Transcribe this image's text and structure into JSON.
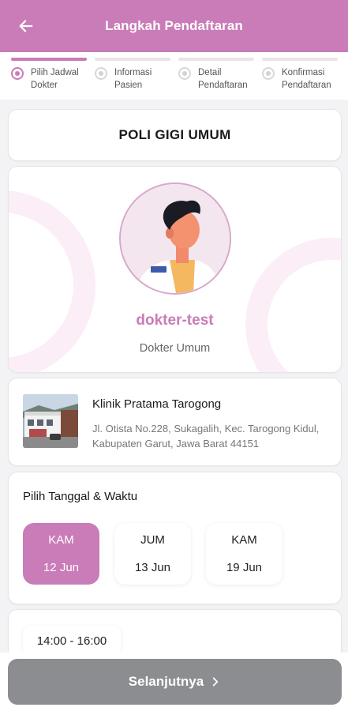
{
  "header": {
    "title": "Langkah Pendaftaran",
    "back_icon": "arrow-left-icon"
  },
  "stepper": {
    "accent": "#c97cb7",
    "steps": [
      {
        "label": "Pilih Jadwal Dokter",
        "active": true
      },
      {
        "label": "Informasi Pasien",
        "active": false
      },
      {
        "label": "Detail Pendaftaran",
        "active": false
      },
      {
        "label": "Konfirmasi Pendaftaran",
        "active": false
      }
    ]
  },
  "poli": {
    "title": "POLI GIGI UMUM"
  },
  "doctor": {
    "name": "dokter-test",
    "specialty": "Dokter Umum",
    "avatar_icon": "doctor-avatar"
  },
  "clinic": {
    "name": "Klinik Pratama Tarogong",
    "address": "Jl. Otista No.228, Sukagalih, Kec. Tarogong Kidul, Kabupaten Garut, Jawa Barat 44151"
  },
  "schedule": {
    "heading": "Pilih Tanggal & Waktu",
    "dates": [
      {
        "day": "KAM",
        "date": "12 Jun",
        "selected": true
      },
      {
        "day": "JUM",
        "date": "13 Jun",
        "selected": false
      },
      {
        "day": "KAM",
        "date": "19 Jun",
        "selected": false
      }
    ],
    "times": [
      {
        "label": "14:00 - 16:00"
      }
    ]
  },
  "footer": {
    "next_label": "Selanjutnya",
    "next_icon": "chevron-right-icon",
    "button_color": "#8b8d90"
  }
}
